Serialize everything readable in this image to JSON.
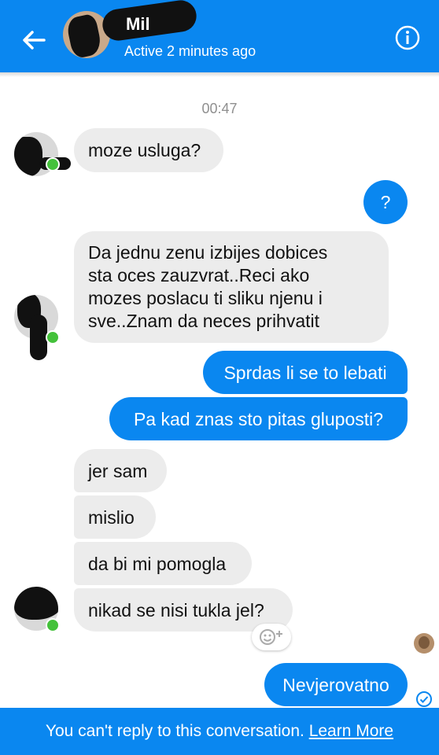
{
  "header": {
    "name": "Mil",
    "status": "Active 2 minutes ago"
  },
  "timestamp": "00:47",
  "messages": [
    {
      "from": "them",
      "text": "moze usluga?"
    },
    {
      "from": "me",
      "text": "?"
    },
    {
      "from": "them",
      "lines": [
        "Da jednu zenu izbijes dobices",
        "sta oces zauzvrat..Reci ako",
        "mozes poslacu ti sliku njenu i",
        "sve..Znam da neces prihvatit"
      ]
    },
    {
      "from": "me",
      "text": "Sprdas li se to lebati"
    },
    {
      "from": "me",
      "text": "Pa kad znas sto pitas gluposti?"
    },
    {
      "from": "them",
      "text": "jer sam"
    },
    {
      "from": "them",
      "text": "mislio"
    },
    {
      "from": "them",
      "text": "da bi mi pomogla"
    },
    {
      "from": "them",
      "text": "nikad se nisi tukla jel?"
    },
    {
      "from": "me",
      "text": "Nevjerovatno"
    }
  ],
  "footer": {
    "text": "You can't reply to this conversation.",
    "link": "Learn More"
  },
  "colors": {
    "accent": "#0a87f0",
    "incoming_bubble": "#ececec",
    "online": "#44c13b"
  },
  "icons": [
    "back-arrow-icon",
    "info-icon",
    "reaction-emoji-icon",
    "delivered-check-icon"
  ]
}
